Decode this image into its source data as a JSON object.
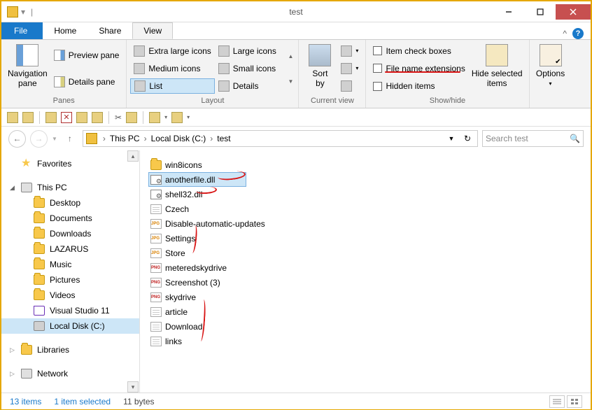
{
  "window": {
    "title": "test"
  },
  "tabs": {
    "file": "File",
    "home": "Home",
    "share": "Share",
    "view": "View"
  },
  "ribbon": {
    "panes": {
      "label": "Panes",
      "nav": "Navigation\npane",
      "preview": "Preview pane",
      "details": "Details pane"
    },
    "layout": {
      "label": "Layout",
      "xl": "Extra large icons",
      "l": "Large icons",
      "m": "Medium icons",
      "s": "Small icons",
      "list": "List",
      "det": "Details"
    },
    "curview": {
      "label": "Current view",
      "sortby": "Sort\nby"
    },
    "showhide": {
      "label": "Show/hide",
      "checkboxes": "Item check boxes",
      "extensions": "File name extensions",
      "hidden": "Hidden items",
      "hidesel": "Hide selected\nitems"
    },
    "options": "Options"
  },
  "breadcrumb": [
    "This PC",
    "Local Disk (C:)",
    "test"
  ],
  "search_placeholder": "Search test",
  "sidebar": {
    "favorites": "Favorites",
    "thispc": "This PC",
    "items": [
      "Desktop",
      "Documents",
      "Downloads",
      "LAZARUS",
      "Music",
      "Pictures",
      "Videos",
      "Visual Studio 11",
      "Local Disk (C:)"
    ],
    "libraries": "Libraries",
    "network": "Network"
  },
  "files": [
    {
      "name": "win8icons",
      "type": "folder"
    },
    {
      "name": "anotherfile.dll",
      "type": "dll",
      "selected": true
    },
    {
      "name": "shell32.dll",
      "type": "dll"
    },
    {
      "name": "Czech",
      "type": "txt"
    },
    {
      "name": "Disable-automatic-updates",
      "type": "jpg"
    },
    {
      "name": "Settings",
      "type": "jpg"
    },
    {
      "name": "Store",
      "type": "jpg"
    },
    {
      "name": "meteredskydrive",
      "type": "png"
    },
    {
      "name": "Screenshot (3)",
      "type": "png"
    },
    {
      "name": "skydrive",
      "type": "png"
    },
    {
      "name": "article",
      "type": "txt"
    },
    {
      "name": "Download",
      "type": "txt"
    },
    {
      "name": "links",
      "type": "txt"
    }
  ],
  "status": {
    "count": "13 items",
    "sel": "1 item selected",
    "size": "11 bytes"
  }
}
